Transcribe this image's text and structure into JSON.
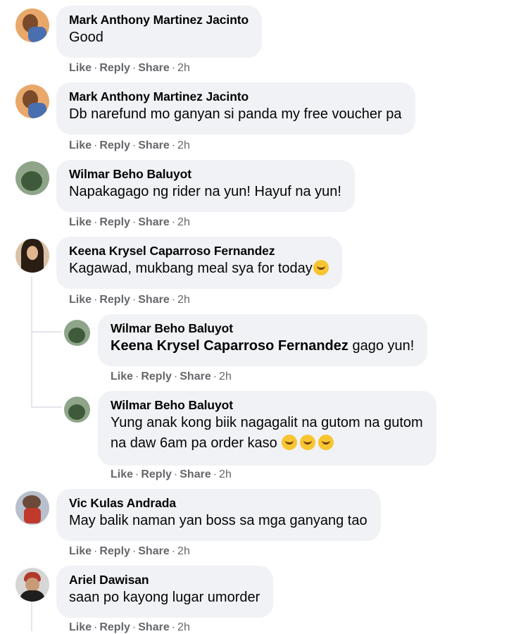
{
  "comments": [
    {
      "author": "Mark Anthony Martinez Jacinto",
      "text": "Good",
      "avatar": "avatar-photo",
      "actions": {
        "like": "Like",
        "reply": "Reply",
        "share": "Share",
        "time": "2h"
      }
    },
    {
      "author": "Mark Anthony Martinez Jacinto",
      "text": "Db narefund mo ganyan si panda my free voucher pa",
      "avatar": "avatar-photo",
      "actions": {
        "like": "Like",
        "reply": "Reply",
        "share": "Share",
        "time": "2h"
      }
    },
    {
      "author": "Wilmar Beho Baluyot",
      "text": "Napakagago ng rider na yun! Hayuf na yun!",
      "avatar": "avatar-photo",
      "actions": {
        "like": "Like",
        "reply": "Reply",
        "share": "Share",
        "time": "2h"
      }
    },
    {
      "author": "Keena Krysel Caparroso Fernandez",
      "text": "Kagawad, mukbang meal sya for today",
      "emoji": "grinning-sweat-emoji",
      "avatar": "avatar-photo",
      "actions": {
        "like": "Like",
        "reply": "Reply",
        "share": "Share",
        "time": "2h"
      },
      "replies": [
        {
          "author": "Wilmar Beho Baluyot",
          "mention": "Keena Krysel Caparroso Fernandez",
          "text": " gago yun!",
          "avatar": "avatar-photo",
          "actions": {
            "like": "Like",
            "reply": "Reply",
            "share": "Share",
            "time": "2h"
          }
        },
        {
          "author": "Wilmar Beho Baluyot",
          "text_line1": "Yung anak kong biik nagagalit na gutom na gutom",
          "text_line2": "na daw 6am pa order kaso ",
          "emojis": [
            "grinning-sweat-emoji",
            "relieved-emoji",
            "grinning-sweat-emoji"
          ],
          "avatar": "avatar-photo",
          "actions": {
            "like": "Like",
            "reply": "Reply",
            "share": "Share",
            "time": "2h"
          }
        }
      ]
    },
    {
      "author": "Vic Kulas Andrada",
      "text": "May balik naman yan boss sa mga ganyang tao",
      "avatar": "avatar-photo",
      "actions": {
        "like": "Like",
        "reply": "Reply",
        "share": "Share",
        "time": "2h"
      }
    },
    {
      "author": "Ariel Dawisan",
      "text": "saan po kayong lugar umorder",
      "avatar": "avatar-photo",
      "actions": {
        "like": "Like",
        "reply": "Reply",
        "share": "Share",
        "time": "2h"
      }
    }
  ],
  "colors": {
    "bubble": "#f0f2f5",
    "meta": "#65676b",
    "text": "#050505",
    "thread_line": "#e4e6eb"
  }
}
